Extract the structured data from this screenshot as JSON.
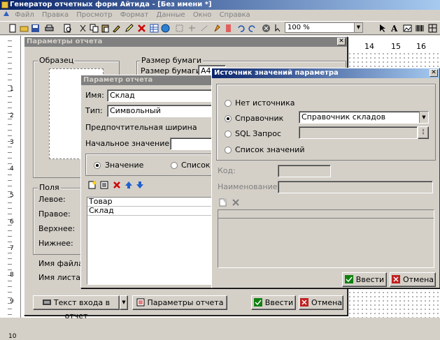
{
  "app": {
    "title": "Генератор отчетных форм Айтида - [Без имени *]",
    "menu": [
      "Файл",
      "Правка",
      "Просмотр",
      "Формат",
      "Данные",
      "Окно",
      "Справка"
    ],
    "zoom": "100 %",
    "ruler_top_labels": [
      "14",
      "15",
      "16"
    ],
    "ruler_left_labels": [
      "1",
      "2",
      "3",
      "4",
      "5",
      "6",
      "7",
      "8",
      "9",
      "10"
    ]
  },
  "report_params": {
    "title": "Параметры отчета",
    "sample_group": "Образец",
    "paper_group": "Размер бумаги",
    "paper_size_label": "Размер бумаги:",
    "paper_size_value": "A4",
    "fields_group": "Поля",
    "left_label": "Левое:",
    "right_label": "Правое:",
    "top_label": "Верхнее:",
    "bottom_label": "Нижнее:",
    "file_name_label": "Имя файла",
    "sheet_name_label": "Имя листа в",
    "entry_text_button": "Текст входа в отчет",
    "params_button": "Параметры отчета",
    "ok_button": "Ввести",
    "cancel_button": "Отмена"
  },
  "report_param": {
    "title": "Параметр отчета",
    "name_label": "Имя:",
    "name_value": "Склад",
    "type_label": "Тип:",
    "type_value": "Символьный",
    "preferred_width_label": "Предпочтительная ширина",
    "initial_value_label": "Начальное значение:",
    "initial_value": "",
    "radio_value": "Значение",
    "radio_list": "Список",
    "list_items": [
      "Товар",
      "Склад"
    ]
  },
  "value_source": {
    "title": "Источник значений параметра",
    "opt_none": "Нет источника",
    "opt_reference": "Справочник",
    "opt_sql": "SQL Запрос",
    "opt_list": "Список значений",
    "selected": "Справочник",
    "reference_value": "Справочник складов",
    "sql_value": "",
    "code_label": "Код:",
    "code_value": "",
    "name_label": "Наименование:",
    "name_value": "",
    "ok_button": "Ввести",
    "cancel_button": "Отмена"
  }
}
